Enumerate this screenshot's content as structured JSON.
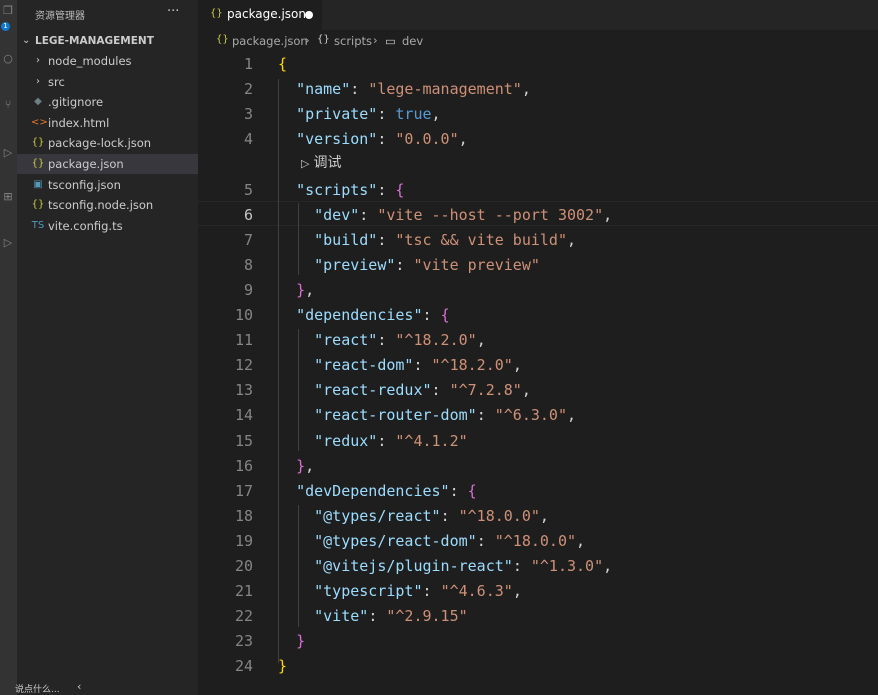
{
  "sidebar": {
    "title": "资源管理器",
    "more_label": "···",
    "project": "LEGE-MANAGEMENT",
    "activity_badge": "1",
    "items": [
      {
        "label": "node_modules",
        "icon": "chevron-right-icon",
        "glyph": "›",
        "color": "#cccccc"
      },
      {
        "label": "src",
        "icon": "chevron-right-icon",
        "glyph": "›",
        "color": "#cccccc"
      },
      {
        "label": ".gitignore",
        "icon": "git-diamond-icon",
        "glyph": "◆",
        "color": "#6d8086"
      },
      {
        "label": "index.html",
        "icon": "html-icon",
        "glyph": "<>",
        "color": "#e37933"
      },
      {
        "label": "package-lock.json",
        "icon": "json-icon",
        "glyph": "{}",
        "color": "#cbcb41"
      },
      {
        "label": "package.json",
        "icon": "json-icon",
        "glyph": "{}",
        "color": "#cbcb41"
      },
      {
        "label": "tsconfig.json",
        "icon": "tsconfig-icon",
        "glyph": "▣",
        "color": "#519aba"
      },
      {
        "label": "tsconfig.node.json",
        "icon": "json-icon",
        "glyph": "{}",
        "color": "#cbcb41"
      },
      {
        "label": "vite.config.ts",
        "icon": "typescript-icon",
        "glyph": "TS",
        "color": "#519aba"
      }
    ],
    "hint": "说点什么...",
    "hint_back": "‹"
  },
  "tab": {
    "label": "package.json",
    "icon": "json-icon",
    "icon_glyph": "{}"
  },
  "breadcrumbs": {
    "file_icon": "{}",
    "file": "package.json",
    "sep1": "›",
    "scripts_icon": "{}",
    "scripts": "scripts",
    "sep2": "›",
    "dev_icon": "▭",
    "dev": "dev"
  },
  "codelens": {
    "icon": "▷",
    "label": "调试"
  },
  "editor": {
    "current_line": 6,
    "lines": [
      {
        "n": "1",
        "t": [
          [
            "br1",
            "{"
          ]
        ]
      },
      {
        "n": "2",
        "t": [
          [
            "p",
            "  "
          ],
          [
            "k",
            "\"name\""
          ],
          [
            "p",
            ": "
          ],
          [
            "s",
            "\"lege-management\""
          ],
          [
            "p",
            ","
          ]
        ]
      },
      {
        "n": "3",
        "t": [
          [
            "p",
            "  "
          ],
          [
            "k",
            "\"private\""
          ],
          [
            "p",
            ": "
          ],
          [
            "b",
            "true"
          ],
          [
            "p",
            ","
          ]
        ]
      },
      {
        "n": "4",
        "t": [
          [
            "p",
            "  "
          ],
          [
            "k",
            "\"version\""
          ],
          [
            "p",
            ": "
          ],
          [
            "s",
            "\"0.0.0\""
          ],
          [
            "p",
            ","
          ]
        ]
      },
      {
        "n": "5",
        "t": [
          [
            "p",
            "  "
          ],
          [
            "k",
            "\"scripts\""
          ],
          [
            "p",
            ": "
          ],
          [
            "br2",
            "{"
          ]
        ]
      },
      {
        "n": "6",
        "t": [
          [
            "p",
            "    "
          ],
          [
            "k",
            "\"dev\""
          ],
          [
            "p",
            ": "
          ],
          [
            "s",
            "\"vite --host --port 3002\""
          ],
          [
            "p",
            ","
          ]
        ]
      },
      {
        "n": "7",
        "t": [
          [
            "p",
            "    "
          ],
          [
            "k",
            "\"build\""
          ],
          [
            "p",
            ": "
          ],
          [
            "s",
            "\"tsc && vite build\""
          ],
          [
            "p",
            ","
          ]
        ]
      },
      {
        "n": "8",
        "t": [
          [
            "p",
            "    "
          ],
          [
            "k",
            "\"preview\""
          ],
          [
            "p",
            ": "
          ],
          [
            "s",
            "\"vite preview\""
          ]
        ]
      },
      {
        "n": "9",
        "t": [
          [
            "p",
            "  "
          ],
          [
            "br2",
            "}"
          ],
          [
            "p",
            ","
          ]
        ]
      },
      {
        "n": "10",
        "t": [
          [
            "p",
            "  "
          ],
          [
            "k",
            "\"dependencies\""
          ],
          [
            "p",
            ": "
          ],
          [
            "br2",
            "{"
          ]
        ]
      },
      {
        "n": "11",
        "t": [
          [
            "p",
            "    "
          ],
          [
            "k",
            "\"react\""
          ],
          [
            "p",
            ": "
          ],
          [
            "s",
            "\"^18.2.0\""
          ],
          [
            "p",
            ","
          ]
        ]
      },
      {
        "n": "12",
        "t": [
          [
            "p",
            "    "
          ],
          [
            "k",
            "\"react-dom\""
          ],
          [
            "p",
            ": "
          ],
          [
            "s",
            "\"^18.2.0\""
          ],
          [
            "p",
            ","
          ]
        ]
      },
      {
        "n": "13",
        "t": [
          [
            "p",
            "    "
          ],
          [
            "k",
            "\"react-redux\""
          ],
          [
            "p",
            ": "
          ],
          [
            "s",
            "\"^7.2.8\""
          ],
          [
            "p",
            ","
          ]
        ]
      },
      {
        "n": "14",
        "t": [
          [
            "p",
            "    "
          ],
          [
            "k",
            "\"react-router-dom\""
          ],
          [
            "p",
            ": "
          ],
          [
            "s",
            "\"^6.3.0\""
          ],
          [
            "p",
            ","
          ]
        ]
      },
      {
        "n": "15",
        "t": [
          [
            "p",
            "    "
          ],
          [
            "k",
            "\"redux\""
          ],
          [
            "p",
            ": "
          ],
          [
            "s",
            "\"^4.1.2\""
          ]
        ]
      },
      {
        "n": "16",
        "t": [
          [
            "p",
            "  "
          ],
          [
            "br2",
            "}"
          ],
          [
            "p",
            ","
          ]
        ]
      },
      {
        "n": "17",
        "t": [
          [
            "p",
            "  "
          ],
          [
            "k",
            "\"devDependencies\""
          ],
          [
            "p",
            ": "
          ],
          [
            "br2",
            "{"
          ]
        ]
      },
      {
        "n": "18",
        "t": [
          [
            "p",
            "    "
          ],
          [
            "k",
            "\"@types/react\""
          ],
          [
            "p",
            ": "
          ],
          [
            "s",
            "\"^18.0.0\""
          ],
          [
            "p",
            ","
          ]
        ]
      },
      {
        "n": "19",
        "t": [
          [
            "p",
            "    "
          ],
          [
            "k",
            "\"@types/react-dom\""
          ],
          [
            "p",
            ": "
          ],
          [
            "s",
            "\"^18.0.0\""
          ],
          [
            "p",
            ","
          ]
        ]
      },
      {
        "n": "20",
        "t": [
          [
            "p",
            "    "
          ],
          [
            "k",
            "\"@vitejs/plugin-react\""
          ],
          [
            "p",
            ": "
          ],
          [
            "s",
            "\"^1.3.0\""
          ],
          [
            "p",
            ","
          ]
        ]
      },
      {
        "n": "21",
        "t": [
          [
            "p",
            "    "
          ],
          [
            "k",
            "\"typescript\""
          ],
          [
            "p",
            ": "
          ],
          [
            "s",
            "\"^4.6.3\""
          ],
          [
            "p",
            ","
          ]
        ]
      },
      {
        "n": "22",
        "t": [
          [
            "p",
            "    "
          ],
          [
            "k",
            "\"vite\""
          ],
          [
            "p",
            ": "
          ],
          [
            "s",
            "\"^2.9.15\""
          ]
        ]
      },
      {
        "n": "23",
        "t": [
          [
            "p",
            "  "
          ],
          [
            "br2",
            "}"
          ]
        ]
      },
      {
        "n": "24",
        "t": [
          [
            "br1",
            "}"
          ]
        ]
      }
    ]
  }
}
